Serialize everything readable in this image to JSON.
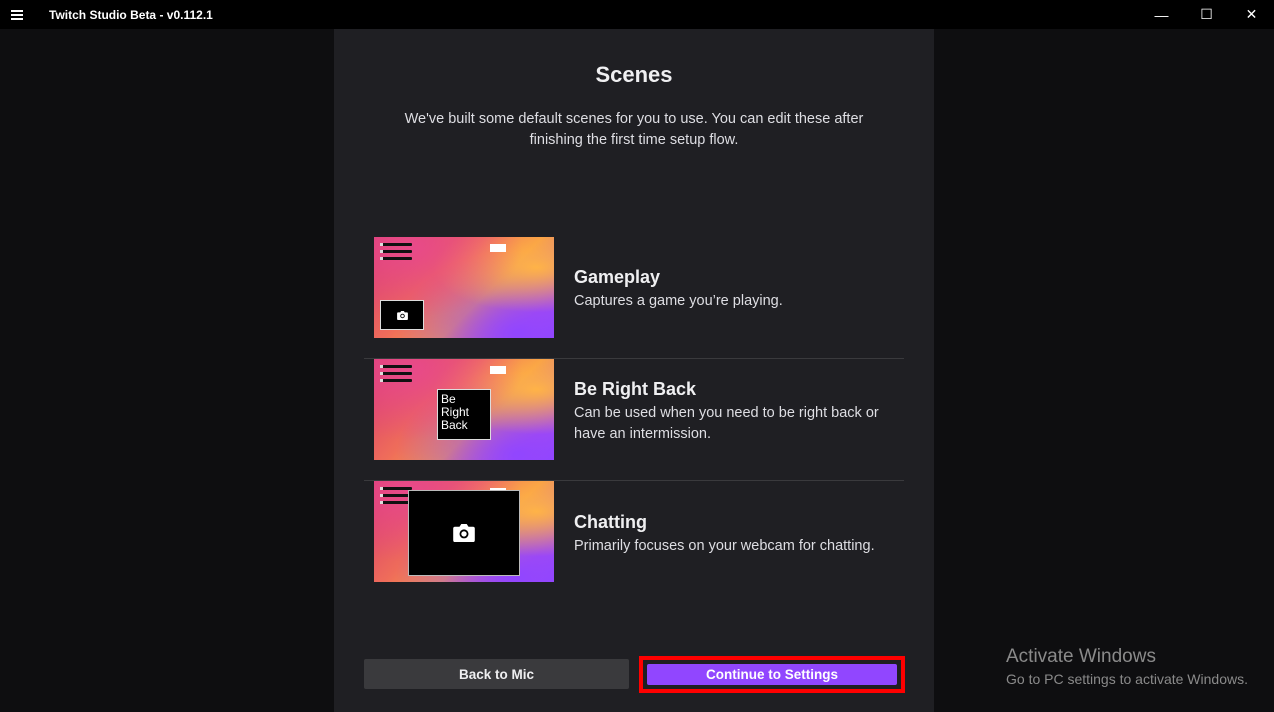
{
  "window": {
    "title": "Twitch Studio Beta - v0.112.1",
    "controls": {
      "minimize": "—",
      "maximize": "☐",
      "close": "✕"
    }
  },
  "page": {
    "title": "Scenes",
    "description": "We've built some default scenes for you to use. You can edit these after finishing the first time setup flow."
  },
  "scenes": [
    {
      "name": "Gameplay",
      "description": "Captures a game you’re playing."
    },
    {
      "name": "Be Right Back",
      "description": "Can be used when you need to be right back or have an intermission.",
      "thumb_text": "Be Right Back"
    },
    {
      "name": "Chatting",
      "description": "Primarily focuses on your webcam for chatting."
    }
  ],
  "buttons": {
    "back": "Back to Mic",
    "continue": "Continue to Settings"
  },
  "watermark": {
    "line1": "Activate Windows",
    "line2": "Go to PC settings to activate Windows."
  },
  "colors": {
    "accent": "#9146ff",
    "panel": "#1f1f23",
    "highlight": "#ff0000"
  },
  "icons": {
    "menu": "hamburger-icon",
    "camera": "camera-icon"
  }
}
